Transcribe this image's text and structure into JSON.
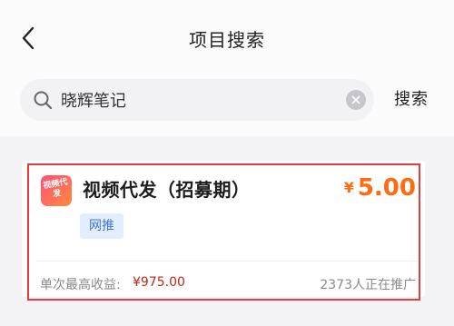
{
  "header": {
    "title": "项目搜索",
    "back_icon": "chevron-left-icon"
  },
  "search": {
    "query": "晓辉笔记",
    "button_label": "搜索",
    "search_icon": "search-icon",
    "clear_icon": "clear-circle-icon"
  },
  "results": [
    {
      "logo_text": "视频代发",
      "title": "视频代发（招募期）",
      "currency": "¥",
      "price": "5.00",
      "tag": "网推",
      "max_earn_label": "单次最高收益:",
      "max_earn_value": "¥975.00",
      "promoting": "2373人正在推广"
    }
  ],
  "colors": {
    "accent_price": "#ff6a13",
    "earn_value": "#c0261e",
    "tag_bg": "#e3eefc",
    "tag_text": "#3c74d6",
    "highlight_border": "#e53d3d"
  }
}
